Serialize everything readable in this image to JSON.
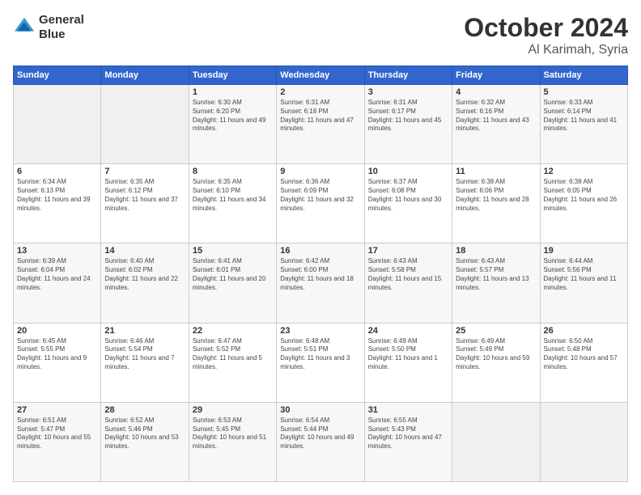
{
  "header": {
    "logo_line1": "General",
    "logo_line2": "Blue",
    "month": "October 2024",
    "location": "Al Karimah, Syria"
  },
  "weekdays": [
    "Sunday",
    "Monday",
    "Tuesday",
    "Wednesday",
    "Thursday",
    "Friday",
    "Saturday"
  ],
  "weeks": [
    [
      {
        "day": "",
        "info": ""
      },
      {
        "day": "",
        "info": ""
      },
      {
        "day": "1",
        "info": "Sunrise: 6:30 AM\nSunset: 6:20 PM\nDaylight: 11 hours and 49 minutes."
      },
      {
        "day": "2",
        "info": "Sunrise: 6:31 AM\nSunset: 6:18 PM\nDaylight: 11 hours and 47 minutes."
      },
      {
        "day": "3",
        "info": "Sunrise: 6:31 AM\nSunset: 6:17 PM\nDaylight: 11 hours and 45 minutes."
      },
      {
        "day": "4",
        "info": "Sunrise: 6:32 AM\nSunset: 6:16 PM\nDaylight: 11 hours and 43 minutes."
      },
      {
        "day": "5",
        "info": "Sunrise: 6:33 AM\nSunset: 6:14 PM\nDaylight: 11 hours and 41 minutes."
      }
    ],
    [
      {
        "day": "6",
        "info": "Sunrise: 6:34 AM\nSunset: 6:13 PM\nDaylight: 11 hours and 39 minutes."
      },
      {
        "day": "7",
        "info": "Sunrise: 6:35 AM\nSunset: 6:12 PM\nDaylight: 11 hours and 37 minutes."
      },
      {
        "day": "8",
        "info": "Sunrise: 6:35 AM\nSunset: 6:10 PM\nDaylight: 11 hours and 34 minutes."
      },
      {
        "day": "9",
        "info": "Sunrise: 6:36 AM\nSunset: 6:09 PM\nDaylight: 11 hours and 32 minutes."
      },
      {
        "day": "10",
        "info": "Sunrise: 6:37 AM\nSunset: 6:08 PM\nDaylight: 11 hours and 30 minutes."
      },
      {
        "day": "11",
        "info": "Sunrise: 6:38 AM\nSunset: 6:06 PM\nDaylight: 11 hours and 28 minutes."
      },
      {
        "day": "12",
        "info": "Sunrise: 6:38 AM\nSunset: 6:05 PM\nDaylight: 11 hours and 26 minutes."
      }
    ],
    [
      {
        "day": "13",
        "info": "Sunrise: 6:39 AM\nSunset: 6:04 PM\nDaylight: 11 hours and 24 minutes."
      },
      {
        "day": "14",
        "info": "Sunrise: 6:40 AM\nSunset: 6:02 PM\nDaylight: 11 hours and 22 minutes."
      },
      {
        "day": "15",
        "info": "Sunrise: 6:41 AM\nSunset: 6:01 PM\nDaylight: 11 hours and 20 minutes."
      },
      {
        "day": "16",
        "info": "Sunrise: 6:42 AM\nSunset: 6:00 PM\nDaylight: 11 hours and 18 minutes."
      },
      {
        "day": "17",
        "info": "Sunrise: 6:43 AM\nSunset: 5:58 PM\nDaylight: 11 hours and 15 minutes."
      },
      {
        "day": "18",
        "info": "Sunrise: 6:43 AM\nSunset: 5:57 PM\nDaylight: 11 hours and 13 minutes."
      },
      {
        "day": "19",
        "info": "Sunrise: 6:44 AM\nSunset: 5:56 PM\nDaylight: 11 hours and 11 minutes."
      }
    ],
    [
      {
        "day": "20",
        "info": "Sunrise: 6:45 AM\nSunset: 5:55 PM\nDaylight: 11 hours and 9 minutes."
      },
      {
        "day": "21",
        "info": "Sunrise: 6:46 AM\nSunset: 5:54 PM\nDaylight: 11 hours and 7 minutes."
      },
      {
        "day": "22",
        "info": "Sunrise: 6:47 AM\nSunset: 5:52 PM\nDaylight: 11 hours and 5 minutes."
      },
      {
        "day": "23",
        "info": "Sunrise: 6:48 AM\nSunset: 5:51 PM\nDaylight: 11 hours and 3 minutes."
      },
      {
        "day": "24",
        "info": "Sunrise: 6:49 AM\nSunset: 5:50 PM\nDaylight: 11 hours and 1 minute."
      },
      {
        "day": "25",
        "info": "Sunrise: 6:49 AM\nSunset: 5:49 PM\nDaylight: 10 hours and 59 minutes."
      },
      {
        "day": "26",
        "info": "Sunrise: 6:50 AM\nSunset: 5:48 PM\nDaylight: 10 hours and 57 minutes."
      }
    ],
    [
      {
        "day": "27",
        "info": "Sunrise: 6:51 AM\nSunset: 5:47 PM\nDaylight: 10 hours and 55 minutes."
      },
      {
        "day": "28",
        "info": "Sunrise: 6:52 AM\nSunset: 5:46 PM\nDaylight: 10 hours and 53 minutes."
      },
      {
        "day": "29",
        "info": "Sunrise: 6:53 AM\nSunset: 5:45 PM\nDaylight: 10 hours and 51 minutes."
      },
      {
        "day": "30",
        "info": "Sunrise: 6:54 AM\nSunset: 5:44 PM\nDaylight: 10 hours and 49 minutes."
      },
      {
        "day": "31",
        "info": "Sunrise: 6:55 AM\nSunset: 5:43 PM\nDaylight: 10 hours and 47 minutes."
      },
      {
        "day": "",
        "info": ""
      },
      {
        "day": "",
        "info": ""
      }
    ]
  ]
}
